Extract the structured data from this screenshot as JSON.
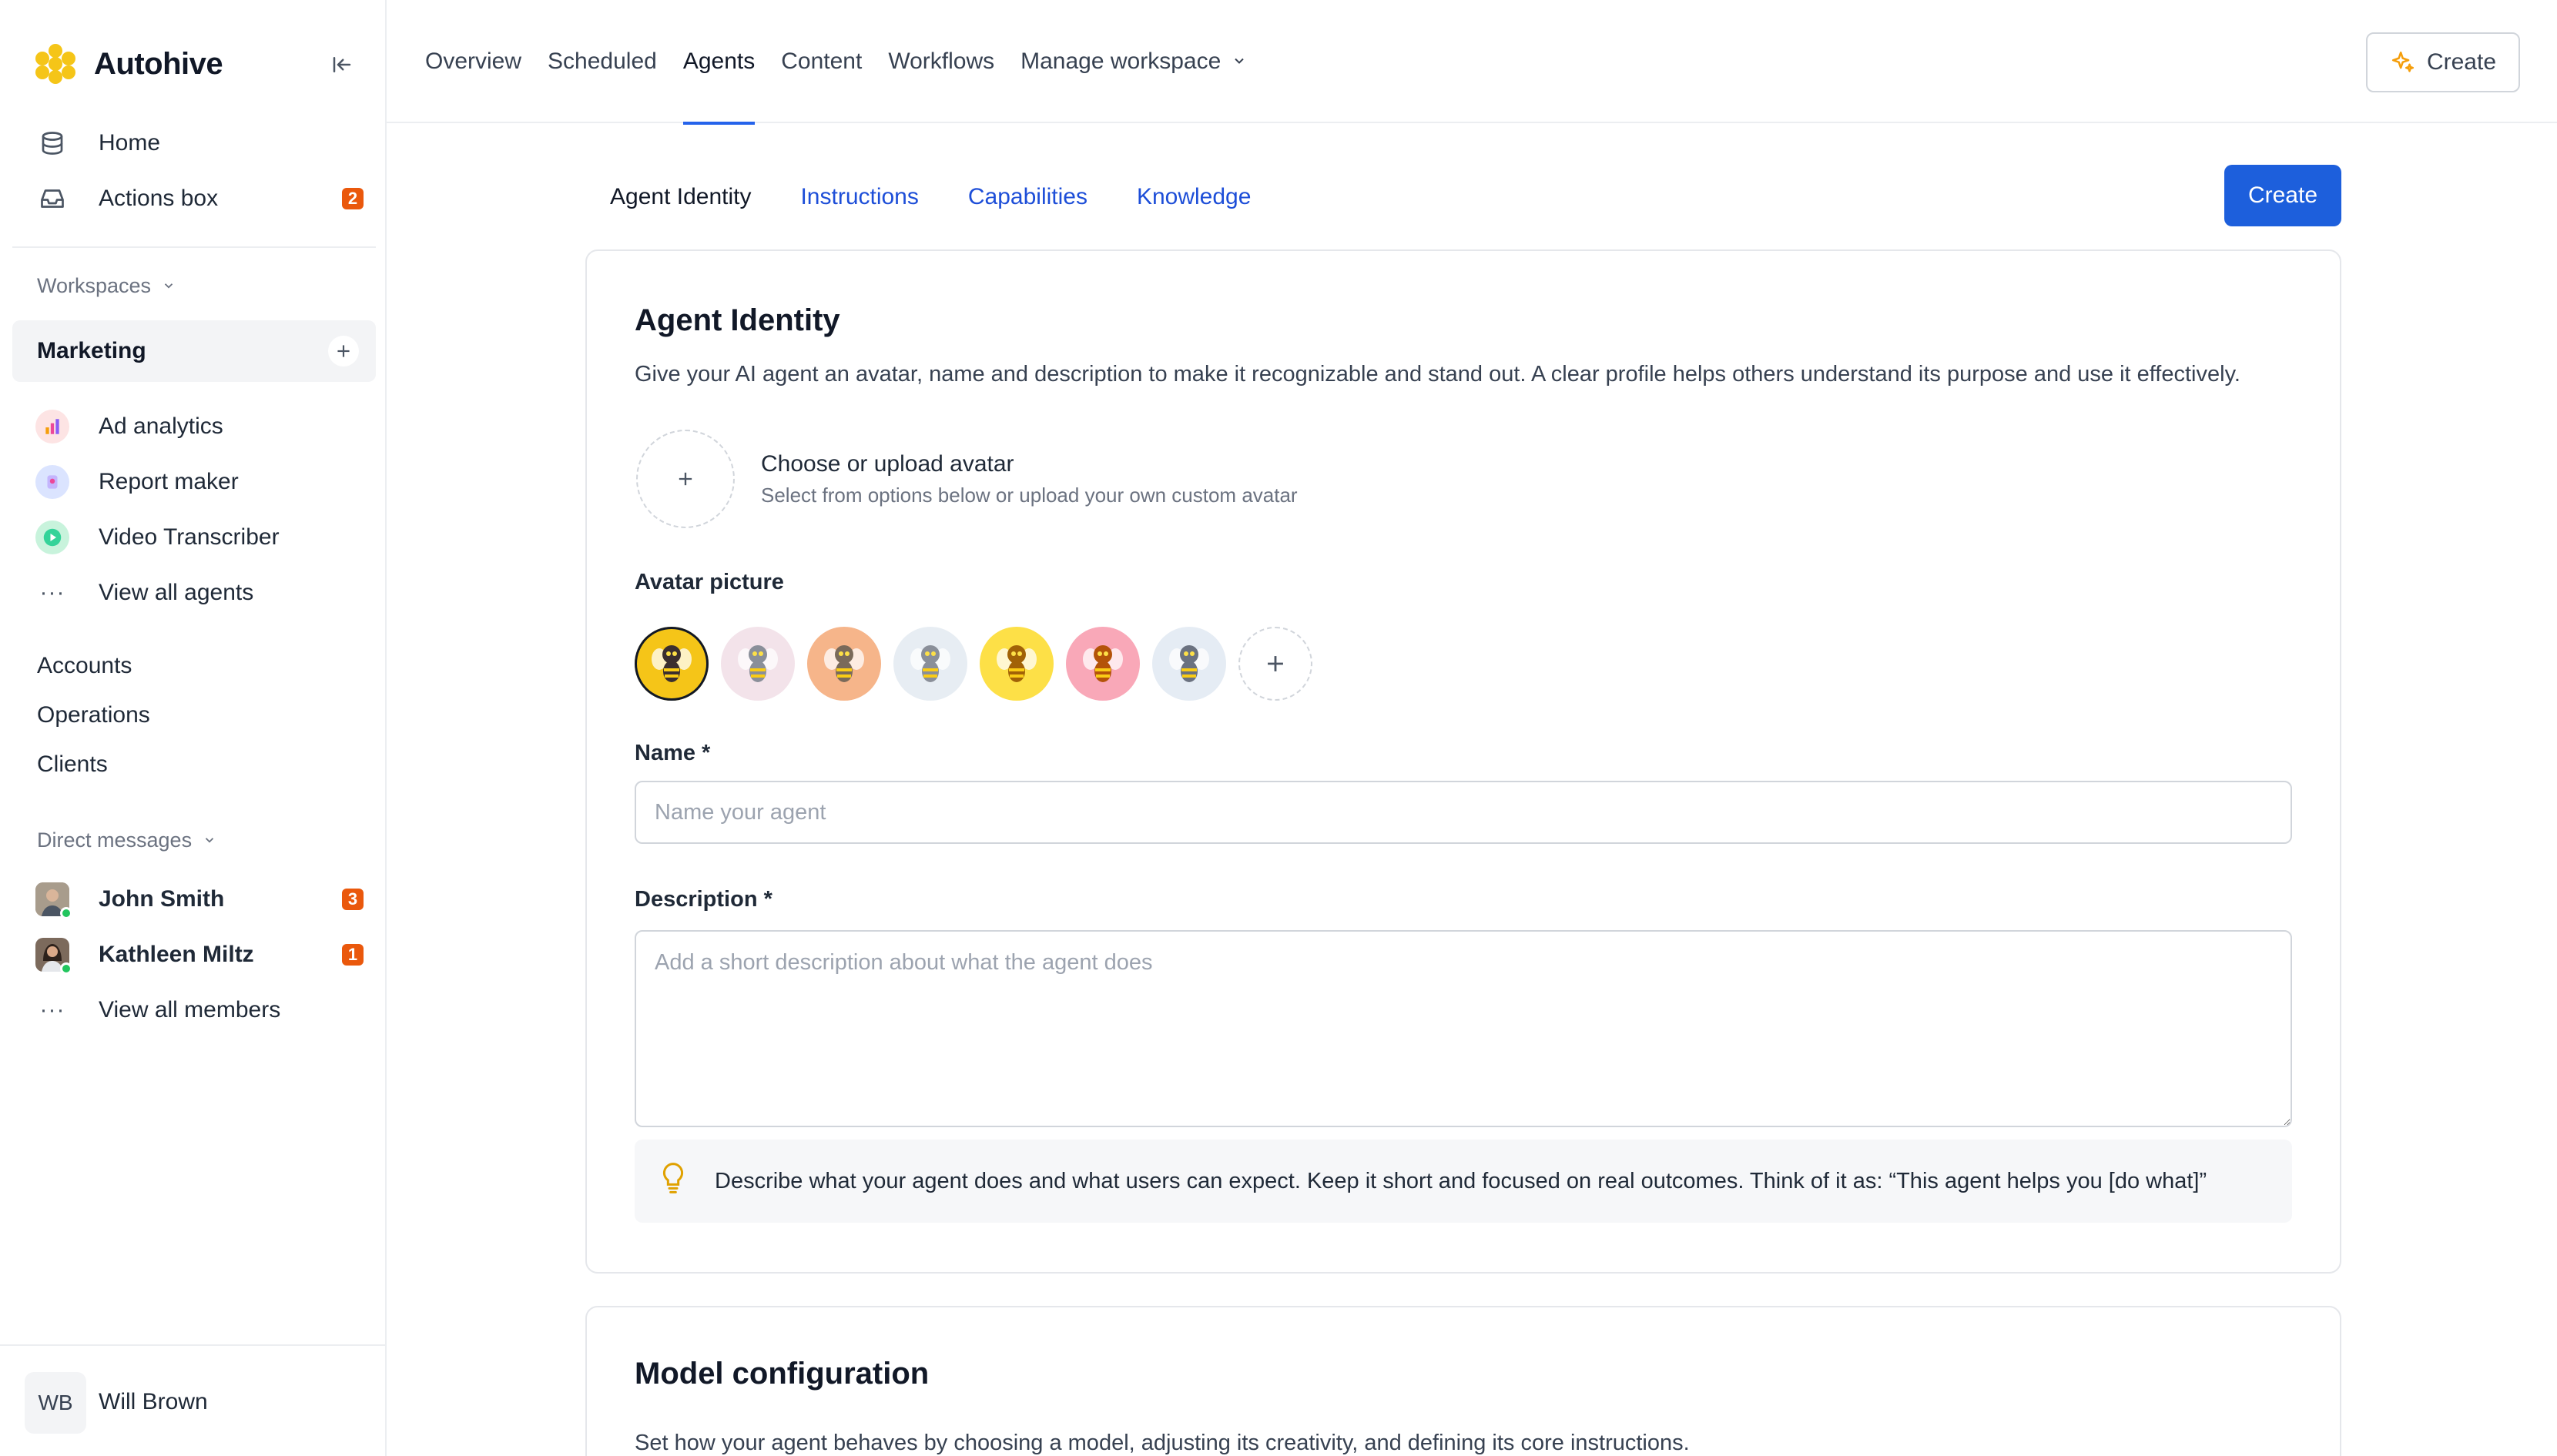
{
  "app": {
    "name": "Autohive"
  },
  "sidebar": {
    "home_label": "Home",
    "actions_label": "Actions box",
    "actions_count": "2",
    "workspaces_label": "Workspaces",
    "active_workspace": "Marketing",
    "agents": [
      {
        "label": "Ad analytics",
        "icon": "bar-chart-icon"
      },
      {
        "label": "Report maker",
        "icon": "report-icon"
      },
      {
        "label": "Video Transcriber",
        "icon": "play-icon"
      }
    ],
    "view_all_agents": "View all agents",
    "workspaces": [
      "Accounts",
      "Operations",
      "Clients"
    ],
    "dm_label": "Direct messages",
    "dms": [
      {
        "name": "John Smith",
        "count": "3"
      },
      {
        "name": "Kathleen Miltz",
        "count": "1"
      }
    ],
    "view_all_members": "View all members",
    "user": {
      "initials": "WB",
      "name": "Will Brown"
    }
  },
  "topnav": {
    "tabs": [
      "Overview",
      "Scheduled",
      "Agents",
      "Content",
      "Workflows"
    ],
    "manage": "Manage workspace",
    "active_tab": "Agents",
    "create_label": "Create"
  },
  "editor": {
    "tabs": [
      "Agent Identity",
      "Instructions",
      "Capabilities",
      "Knowledge"
    ],
    "active_tab": "Agent Identity",
    "create_label": "Create",
    "identity": {
      "title": "Agent Identity",
      "description": "Give your AI agent an avatar, name and description to make it recognizable and stand out. A clear profile helps others understand its purpose and use it effectively.",
      "chooser_title": "Choose or upload avatar",
      "chooser_sub": "Select from options below or upload your own custom avatar",
      "avatar_label": "Avatar picture",
      "avatar_colors": [
        "#f5c518",
        "#f3e3ea",
        "#f6b58a",
        "#e7edf3",
        "#fde047",
        "#f9a8b8",
        "#e5ecf4"
      ],
      "name_label": "Name *",
      "name_placeholder": "Name your agent",
      "desc_label": "Description *",
      "desc_placeholder": "Add a short description about what the agent does",
      "tip": "Describe what your agent does and what users can expect. Keep it short and focused on real outcomes. Think of it as: “This agent helps you [do what]”"
    },
    "model": {
      "title": "Model configuration",
      "description": "Set how your agent behaves by choosing a model, adjusting its creativity, and defining its core instructions."
    }
  },
  "colors": {
    "accent": "#1d5fdc",
    "badge": "#ea580c",
    "brand": "#f5c518"
  }
}
